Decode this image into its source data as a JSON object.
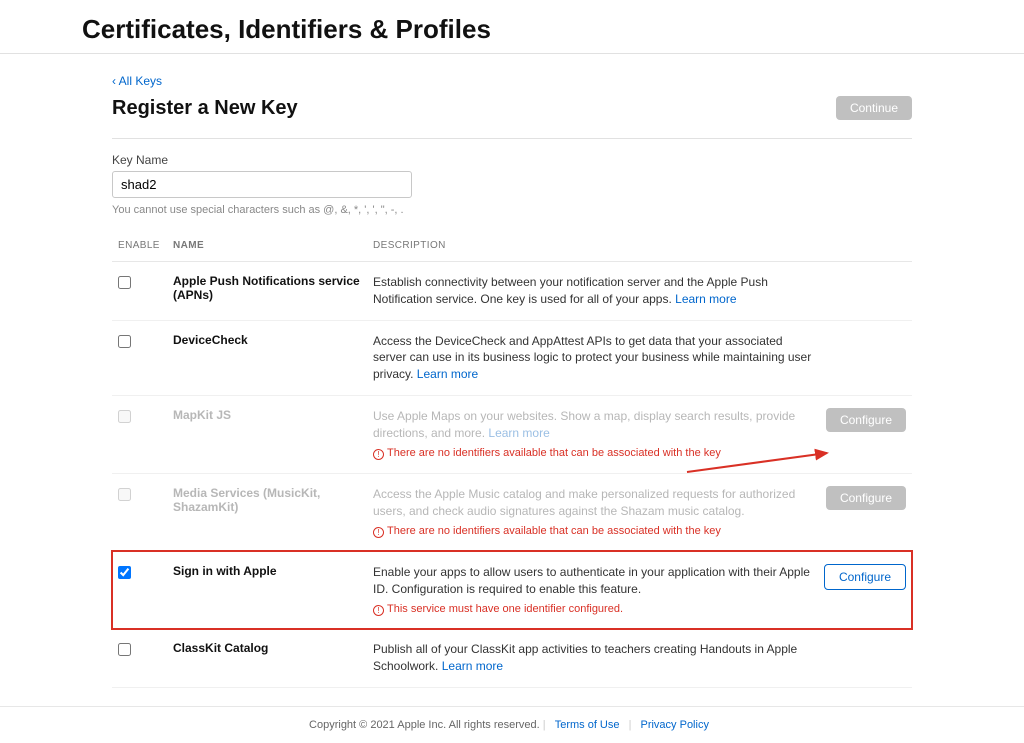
{
  "page_title": "Certificates, Identifiers & Profiles",
  "back_link": "‹ All Keys",
  "register_title": "Register a New Key",
  "continue_label": "Continue",
  "key_name_label": "Key Name",
  "key_name_value": "shad2",
  "key_name_hint": "You cannot use special characters such as @, &, *, ', ', \", -, .",
  "headers": {
    "enable": "ENABLE",
    "name": "NAME",
    "description": "DESCRIPTION"
  },
  "learn_more": "Learn more",
  "configure_label": "Configure",
  "errors": {
    "no_identifiers": "There are no identifiers available that can be associated with the key",
    "must_have_identifier": "This service must have one identifier configured."
  },
  "rows": {
    "apns": {
      "name": "Apple Push Notifications service (APNs)",
      "desc": "Establish connectivity between your notification server and the Apple Push Notification service. One key is used for all of your apps."
    },
    "devicecheck": {
      "name": "DeviceCheck",
      "desc": "Access the DeviceCheck and AppAttest APIs to get data that your associated server can use in its business logic to protect your business while maintaining user privacy."
    },
    "mapkit": {
      "name": "MapKit JS",
      "desc": "Use Apple Maps on your websites. Show a map, display search results, provide directions, and more."
    },
    "media": {
      "name": "Media Services (MusicKit, ShazamKit)",
      "desc": "Access the Apple Music catalog and make personalized requests for authorized users, and check audio signatures against the Shazam music catalog."
    },
    "siwa": {
      "name": "Sign in with Apple",
      "desc": "Enable your apps to allow users to authenticate in your application with their Apple ID. Configuration is required to enable this feature."
    },
    "classkit": {
      "name": "ClassKit Catalog",
      "desc": "Publish all of your ClassKit app activities to teachers creating Handouts in Apple Schoolwork."
    }
  },
  "footer": {
    "copyright": "Copyright © 2021 Apple Inc. All rights reserved.",
    "terms": "Terms of Use",
    "privacy": "Privacy Policy"
  }
}
